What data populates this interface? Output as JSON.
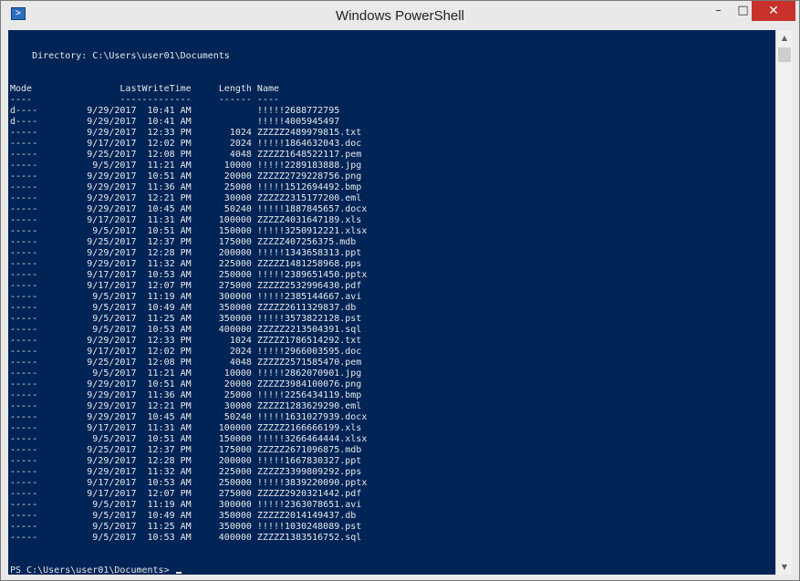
{
  "window": {
    "title": "Windows PowerShell",
    "minimize": "–",
    "maximize": "□",
    "close": "✕",
    "icon": "powershell-icon"
  },
  "console": {
    "directory_line": "    Directory: C:\\Users\\user01\\Documents",
    "col_header": "Mode                LastWriteTime     Length Name",
    "col_underline": "----                -------------     ------ ----",
    "rows": [
      "d----         9/29/2017  10:41 AM            !!!!!2688772795",
      "d----         9/29/2017  10:41 AM            !!!!!4005945497",
      "-----         9/29/2017  12:33 PM       1024 ZZZZZ2489979815.txt",
      "-----         9/17/2017  12:02 PM       2024 !!!!!1864632043.doc",
      "-----         9/25/2017  12:08 PM       4048 ZZZZZ1648522117.pem",
      "-----          9/5/2017  11:21 AM      10000 !!!!!2289183888.jpg",
      "-----         9/29/2017  10:51 AM      20000 ZZZZZ2729228756.png",
      "-----         9/29/2017  11:36 AM      25000 !!!!!1512694492.bmp",
      "-----         9/29/2017  12:21 PM      30000 ZZZZZ2315177200.eml",
      "-----         9/29/2017  10:45 AM      50240 !!!!!1887845657.docx",
      "-----         9/17/2017  11:31 AM     100000 ZZZZZ4031647189.xls",
      "-----          9/5/2017  10:51 AM     150000 !!!!!3250912221.xlsx",
      "-----         9/25/2017  12:37 PM     175000 ZZZZZ407256375.mdb",
      "-----         9/29/2017  12:28 PM     200000 !!!!!1343658313.ppt",
      "-----         9/29/2017  11:32 AM     225000 ZZZZZ1481258968.pps",
      "-----         9/17/2017  10:53 AM     250000 !!!!!2389651450.pptx",
      "-----         9/17/2017  12:07 PM     275000 ZZZZZ2532996430.pdf",
      "-----          9/5/2017  11:19 AM     300000 !!!!!2385144667.avi",
      "-----          9/5/2017  10:49 AM     350000 ZZZZZ2611329837.db",
      "-----          9/5/2017  11:25 AM     350000 !!!!!3573822128.pst",
      "-----          9/5/2017  10:53 AM     400000 ZZZZZ2213504391.sql",
      "-----         9/29/2017  12:33 PM       1024 ZZZZZ1786514292.txt",
      "-----         9/17/2017  12:02 PM       2024 !!!!!2966003595.doc",
      "-----         9/25/2017  12:08 PM       4048 ZZZZZ2571585470.pem",
      "-----          9/5/2017  11:21 AM      10000 !!!!!2862070901.jpg",
      "-----         9/29/2017  10:51 AM      20000 ZZZZZ3984100076.png",
      "-----         9/29/2017  11:36 AM      25000 !!!!!2256434119.bmp",
      "-----         9/29/2017  12:21 PM      30000 ZZZZZ1283629290.eml",
      "-----         9/29/2017  10:45 AM      50240 !!!!!1631027939.docx",
      "-----         9/17/2017  11:31 AM     100000 ZZZZZ2166666199.xls",
      "-----          9/5/2017  10:51 AM     150000 !!!!!3266464444.xlsx",
      "-----         9/25/2017  12:37 PM     175000 ZZZZZ2671096875.mdb",
      "-----         9/29/2017  12:28 PM     200000 !!!!!1667830327.ppt",
      "-----         9/29/2017  11:32 AM     225000 ZZZZZ3399809292.pps",
      "-----         9/17/2017  10:53 AM     250000 !!!!!3839220090.pptx",
      "-----         9/17/2017  12:07 PM     275000 ZZZZZ2920321442.pdf",
      "-----          9/5/2017  11:19 AM     300000 !!!!!2363078651.avi",
      "-----          9/5/2017  10:49 AM     350000 ZZZZZ2014149437.db",
      "-----          9/5/2017  11:25 AM     350000 !!!!!1030248089.pst",
      "-----          9/5/2017  10:53 AM     400000 ZZZZZ1383516752.sql"
    ],
    "prompt": "PS C:\\Users\\user01\\Documents> "
  },
  "scrollbar": {
    "up_icon": "▲",
    "down_icon": "▼"
  },
  "colors": {
    "console_bg": "#012456",
    "console_fg": "#e8e8e8",
    "close_bg": "#c7312a"
  }
}
